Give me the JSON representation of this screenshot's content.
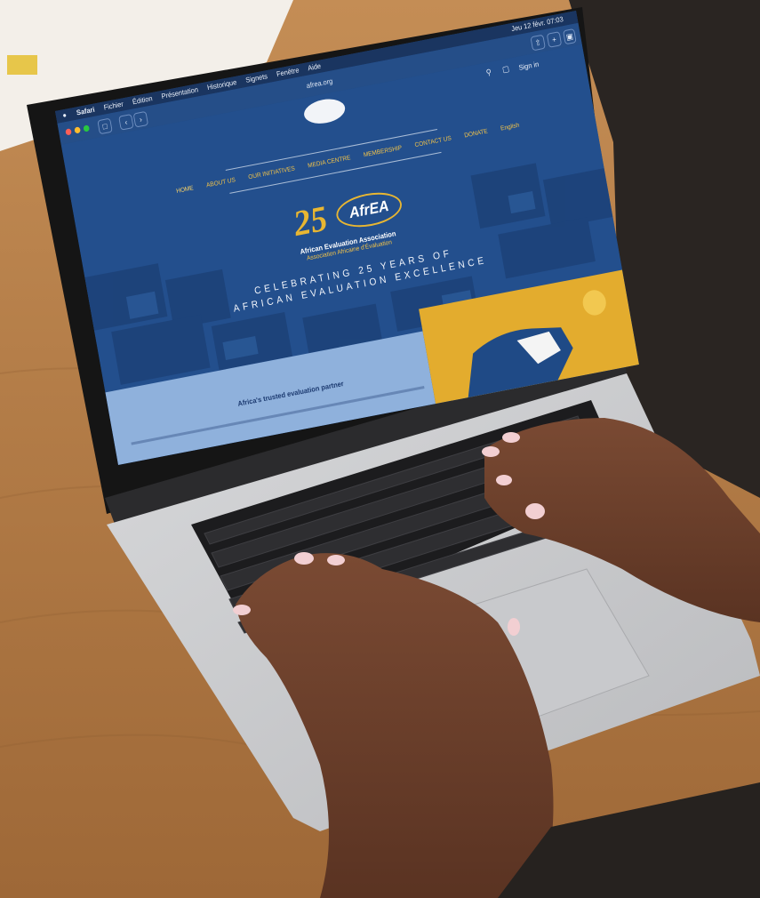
{
  "menubar": {
    "app": "Safari",
    "items": [
      "Fichier",
      "Édition",
      "Présentation",
      "Historique",
      "Signets",
      "Fenêtre",
      "Aide"
    ],
    "clock": "Jeu 12 févr. 07:03"
  },
  "browser": {
    "url": "afrea.org"
  },
  "site": {
    "signin": "Sign in",
    "nav": [
      "HOME",
      "ABOUT US",
      "OUR INITIATIVES",
      "MEDIA CENTRE",
      "MEMBERSHIP",
      "CONTACT US",
      "DONATE",
      "English"
    ],
    "anniversary": "25",
    "brand": "AfrEA",
    "org_name_en": "African Evaluation Association",
    "org_name_fr": "Association Africaine d'Évaluation",
    "headline_line1": "CELEBRATING 25 YEARS OF",
    "headline_line2": "AFRICAN EVALUATION EXCELLENCE",
    "tagline": "Africa's trusted evaluation partner"
  },
  "colors": {
    "site_blue": "#234f8d",
    "gold": "#e3ac2e",
    "light_blue_band": "#8fb1dc",
    "desk": "#b9804a"
  },
  "icons": [
    "apple-icon",
    "sidebar-icon",
    "back-icon",
    "forward-icon",
    "search-icon",
    "cart-icon",
    "share-icon",
    "new-tab-icon",
    "tabs-icon"
  ]
}
